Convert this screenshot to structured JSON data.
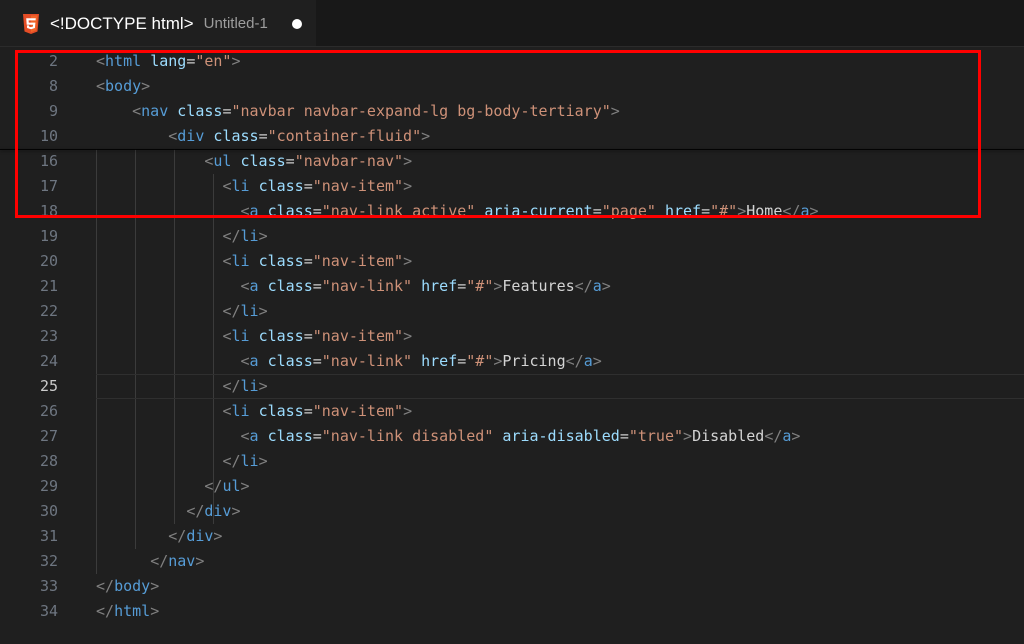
{
  "tab": {
    "title": "<!DOCTYPE html>",
    "file": "Untitled-1",
    "icon": "html5-icon",
    "icon_color": "#e44d26"
  },
  "colors": {
    "background": "#1f1f1f",
    "tag": "#569cd6",
    "attribute": "#9cdcfe",
    "string": "#ce9178",
    "punctuation": "#808080",
    "highlight_box": "#ff0000"
  },
  "lines": [
    {
      "n": "2",
      "code": "<html lang=\"en\">"
    },
    {
      "n": "8",
      "code": "<body>"
    },
    {
      "n": "9",
      "code": "    <nav class=\"navbar navbar-expand-lg bg-body-tertiary\">"
    },
    {
      "n": "10",
      "code": "        <div class=\"container-fluid\">"
    },
    {
      "n": "16",
      "code": "            <ul class=\"navbar-nav\">"
    },
    {
      "n": "17",
      "code": "              <li class=\"nav-item\">"
    },
    {
      "n": "18",
      "code": "                <a class=\"nav-link active\" aria-current=\"page\" href=\"#\">Home</a>"
    },
    {
      "n": "19",
      "code": "              </li>"
    },
    {
      "n": "20",
      "code": "              <li class=\"nav-item\">"
    },
    {
      "n": "21",
      "code": "                <a class=\"nav-link\" href=\"#\">Features</a>"
    },
    {
      "n": "22",
      "code": "              </li>"
    },
    {
      "n": "23",
      "code": "              <li class=\"nav-item\">"
    },
    {
      "n": "24",
      "code": "                <a class=\"nav-link\" href=\"#\">Pricing</a>"
    },
    {
      "n": "25",
      "code": "              </li>"
    },
    {
      "n": "26",
      "code": "              <li class=\"nav-item\">"
    },
    {
      "n": "27",
      "code": "                <a class=\"nav-link disabled\" aria-disabled=\"true\">Disabled</a>"
    },
    {
      "n": "28",
      "code": "              </li>"
    },
    {
      "n": "29",
      "code": "            </ul>"
    },
    {
      "n": "30",
      "code": "          </div>"
    },
    {
      "n": "31",
      "code": "        </div>"
    },
    {
      "n": "32",
      "code": "      </nav>"
    },
    {
      "n": "33",
      "code": "</body>"
    },
    {
      "n": "34",
      "code": "</html>"
    }
  ],
  "current_line": "25"
}
